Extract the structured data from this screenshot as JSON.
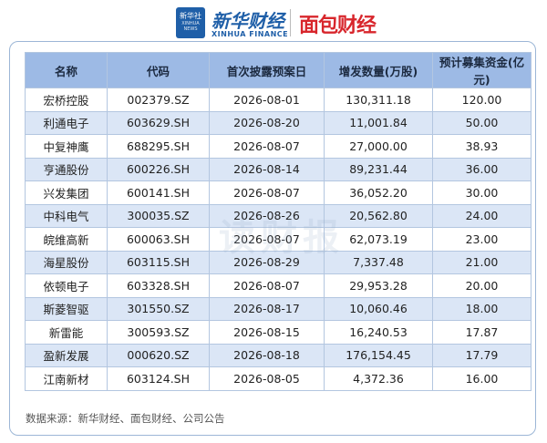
{
  "header": {
    "xinhua_box": "新华社",
    "xinhua_box_small": "XINHUA NEWS",
    "xinhua_finance": "新华财经",
    "xinhua_finance_en": "XINHUA FINANCE",
    "mianbao": "面包财经"
  },
  "table": {
    "columns": [
      "名称",
      "代码",
      "首次披露预案日",
      "增发数量(万股)",
      "预计募集资金(亿元)"
    ],
    "rows": [
      [
        "宏桥控股",
        "002379.SZ",
        "2026-08-01",
        "130,311.18",
        "120.00"
      ],
      [
        "利通电子",
        "603629.SH",
        "2026-08-20",
        "11,001.84",
        "50.00"
      ],
      [
        "中复神鹰",
        "688295.SH",
        "2026-08-07",
        "27,000.00",
        "38.93"
      ],
      [
        "亨通股份",
        "600226.SH",
        "2026-08-14",
        "89,231.44",
        "36.00"
      ],
      [
        "兴发集团",
        "600141.SH",
        "2026-08-07",
        "36,052.20",
        "30.00"
      ],
      [
        "中科电气",
        "300035.SZ",
        "2026-08-26",
        "20,562.80",
        "24.00"
      ],
      [
        "皖维高新",
        "600063.SH",
        "2026-08-07",
        "62,073.19",
        "23.00"
      ],
      [
        "海星股份",
        "603115.SH",
        "2026-08-29",
        "7,337.48",
        "21.00"
      ],
      [
        "依顿电子",
        "603328.SH",
        "2026-08-07",
        "29,953.28",
        "20.00"
      ],
      [
        "斯菱智驱",
        "301550.SZ",
        "2026-08-17",
        "10,060.46",
        "18.00"
      ],
      [
        "新雷能",
        "300593.SZ",
        "2026-08-15",
        "16,240.53",
        "17.87"
      ],
      [
        "盈新发展",
        "000620.SZ",
        "2026-08-18",
        "176,154.45",
        "17.79"
      ],
      [
        "江南新材",
        "603124.SH",
        "2026-08-05",
        "4,372.36",
        "16.00"
      ]
    ]
  },
  "watermark": "读财报",
  "source": "数据来源：新华财经、面包财经、公司公告",
  "colors": {
    "header_bg": "#9dbae5",
    "row_alt": "#dbe6f6",
    "brand_blue": "#1f5fa8",
    "brand_red": "#d8262c"
  }
}
